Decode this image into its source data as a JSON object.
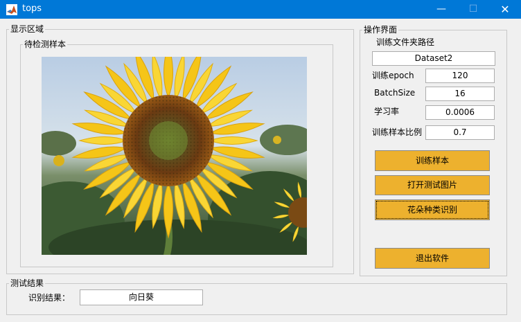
{
  "window": {
    "title": "tops",
    "minimize": "—",
    "maximize": "☐",
    "close": "✕"
  },
  "display_panel": {
    "label": "显示区域",
    "sample_panel": {
      "label": "待检测样本"
    }
  },
  "control_panel": {
    "label": "操作界面",
    "train_path_label": "训练文件夹路径",
    "train_path_value": "Dataset2",
    "epoch_label": "训练epoch",
    "epoch_value": "120",
    "batch_label": "BatchSize",
    "batch_value": "16",
    "lr_label": "学习率",
    "lr_value": "0.0006",
    "ratio_label": "训练样本比例",
    "ratio_value": "0.7",
    "buttons": {
      "train": "训练样本",
      "open_image": "打开测试图片",
      "classify": "花朵种类识别",
      "exit": "退出软件"
    }
  },
  "result_panel": {
    "label": "测试结果",
    "result_label": "识别结果：",
    "result_value": "向日葵"
  },
  "colors": {
    "titlebar": "#0078d7",
    "button": "#edb12e",
    "background": "#f0f0f0"
  }
}
